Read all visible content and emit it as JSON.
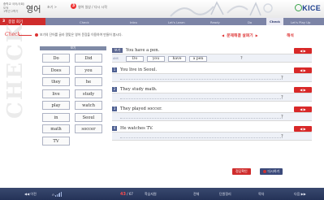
{
  "header": {
    "meta_line1": "중학교 국어/사회/도덕",
    "meta_line2": "1학년 2학기",
    "subject": "영어",
    "crumb": "초기 >",
    "step_no": "3",
    "path_text": "영어 일상 / 다시 시작",
    "logo_text": "KICE"
  },
  "navbar": {
    "lesson": "3",
    "lesson_title": "종합 회기",
    "tabs": [
      "Check",
      "Intro",
      "Let's Learn",
      "Ready",
      "Do",
      "Check",
      "Let's Play Up"
    ],
    "active_tab_index": 5
  },
  "main": {
    "side_watermark": "CHECK",
    "section_label": "Check",
    "instruction": "보기의 단어를 골라 알맞은 영어 문장을 이용하여 만들어 봅시다.",
    "problem_select": "문제해결 살펴기",
    "answer_link": "해석",
    "word_box": {
      "title": "보기",
      "words": [
        "Do",
        "Did",
        "Does",
        "you",
        "they",
        "he",
        "live",
        "study",
        "play",
        "watch",
        "in",
        "Seoul",
        "math",
        "soccer",
        "TV"
      ]
    },
    "example": {
      "badge": "보기",
      "prompt": "You have a pen.",
      "row_label": "ANS",
      "chips": [
        "Do",
        "you",
        "have",
        "a pen"
      ],
      "qmark": "?"
    },
    "questions": [
      {
        "number": "1",
        "prompt": "You live in Seoul.",
        "qmark": "?"
      },
      {
        "number": "2",
        "prompt": "They study math.",
        "qmark": "?"
      },
      {
        "number": "3",
        "prompt": "They played soccer.",
        "qmark": "?"
      },
      {
        "number": "4",
        "prompt": "He watches TV.",
        "qmark": "?"
      }
    ],
    "play_label": "◀ ▶",
    "confirm_label": "정답확인",
    "retry_label": "다시하기"
  },
  "footer": {
    "prev": "◀◀ 이전",
    "volume_icon": "headphone-icon",
    "page_current": "43",
    "page_total": "/ 67",
    "items": [
      "학습지원",
      "전체",
      "단원정리",
      "목차"
    ],
    "next": "다음 ▶▶"
  },
  "colors": {
    "accent_red": "#cf2c2c",
    "nav_blue": "#7c84a6",
    "footer_navy": "#243257"
  }
}
